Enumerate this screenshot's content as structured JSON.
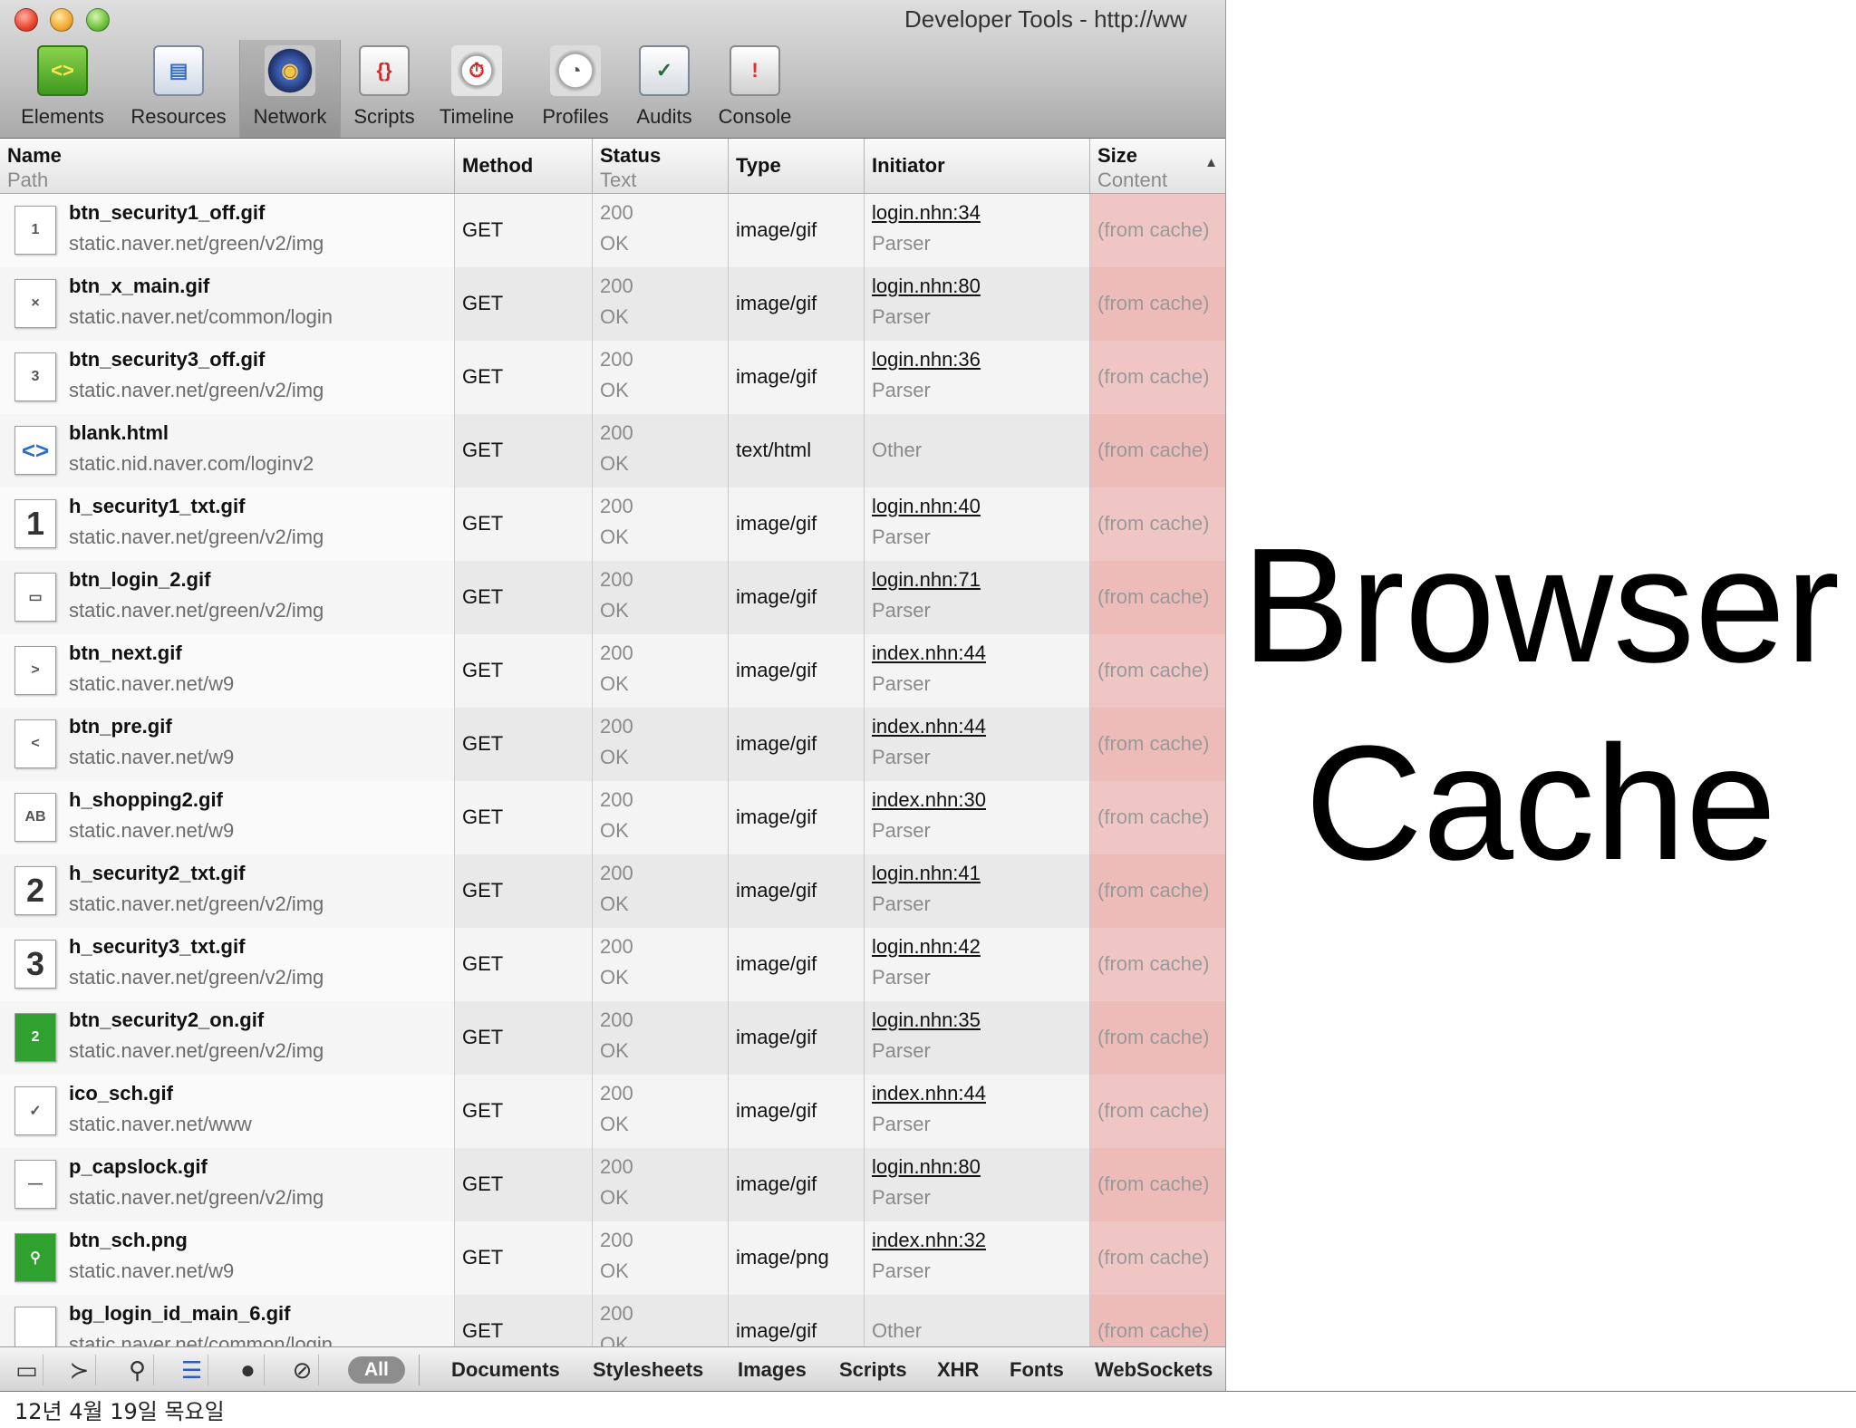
{
  "window": {
    "title": "Developer Tools - http://ww"
  },
  "toolbar": {
    "tabs": [
      {
        "label": "Elements",
        "icon": "elements-icon"
      },
      {
        "label": "Resources",
        "icon": "resources-icon"
      },
      {
        "label": "Network",
        "icon": "network-icon",
        "selected": true
      },
      {
        "label": "Scripts",
        "icon": "scripts-icon"
      },
      {
        "label": "Timeline",
        "icon": "timeline-icon"
      },
      {
        "label": "Profiles",
        "icon": "profiles-icon"
      },
      {
        "label": "Audits",
        "icon": "audits-icon"
      },
      {
        "label": "Console",
        "icon": "console-icon"
      }
    ]
  },
  "columns": {
    "name": "Name",
    "name_sub": "Path",
    "method": "Method",
    "status": "Status",
    "status_sub": "Text",
    "type": "Type",
    "initiator": "Initiator",
    "size": "Size",
    "size_sub": "Content",
    "sort_indicator": "▲"
  },
  "rows": [
    {
      "name": "btn_security1_off.gif",
      "path": "static.naver.net/green/v2/img",
      "method": "GET",
      "status": "200",
      "status_text": "OK",
      "type": "image/gif",
      "initiator": "login.nhn:34",
      "initiator_type": "Parser",
      "size": "(from cache)",
      "thumb": "1"
    },
    {
      "name": "btn_x_main.gif",
      "path": "static.naver.net/common/login",
      "method": "GET",
      "status": "200",
      "status_text": "OK",
      "type": "image/gif",
      "initiator": "login.nhn:80",
      "initiator_type": "Parser",
      "size": "(from cache)",
      "thumb": "×"
    },
    {
      "name": "btn_security3_off.gif",
      "path": "static.naver.net/green/v2/img",
      "method": "GET",
      "status": "200",
      "status_text": "OK",
      "type": "image/gif",
      "initiator": "login.nhn:36",
      "initiator_type": "Parser",
      "size": "(from cache)",
      "thumb": "3"
    },
    {
      "name": "blank.html",
      "path": "static.nid.naver.com/loginv2",
      "method": "GET",
      "status": "200",
      "status_text": "OK",
      "type": "text/html",
      "initiator": "Other",
      "initiator_type": "",
      "size": "(from cache)",
      "thumb": "<>"
    },
    {
      "name": "h_security1_txt.gif",
      "path": "static.naver.net/green/v2/img",
      "method": "GET",
      "status": "200",
      "status_text": "OK",
      "type": "image/gif",
      "initiator": "login.nhn:40",
      "initiator_type": "Parser",
      "size": "(from cache)",
      "thumb": "1"
    },
    {
      "name": "btn_login_2.gif",
      "path": "static.naver.net/green/v2/img",
      "method": "GET",
      "status": "200",
      "status_text": "OK",
      "type": "image/gif",
      "initiator": "login.nhn:71",
      "initiator_type": "Parser",
      "size": "(from cache)",
      "thumb": "▭"
    },
    {
      "name": "btn_next.gif",
      "path": "static.naver.net/w9",
      "method": "GET",
      "status": "200",
      "status_text": "OK",
      "type": "image/gif",
      "initiator": "index.nhn:44",
      "initiator_type": "Parser",
      "size": "(from cache)",
      "thumb": ">"
    },
    {
      "name": "btn_pre.gif",
      "path": "static.naver.net/w9",
      "method": "GET",
      "status": "200",
      "status_text": "OK",
      "type": "image/gif",
      "initiator": "index.nhn:44",
      "initiator_type": "Parser",
      "size": "(from cache)",
      "thumb": "<"
    },
    {
      "name": "h_shopping2.gif",
      "path": "static.naver.net/w9",
      "method": "GET",
      "status": "200",
      "status_text": "OK",
      "type": "image/gif",
      "initiator": "index.nhn:30",
      "initiator_type": "Parser",
      "size": "(from cache)",
      "thumb": "AB"
    },
    {
      "name": "h_security2_txt.gif",
      "path": "static.naver.net/green/v2/img",
      "method": "GET",
      "status": "200",
      "status_text": "OK",
      "type": "image/gif",
      "initiator": "login.nhn:41",
      "initiator_type": "Parser",
      "size": "(from cache)",
      "thumb": "2"
    },
    {
      "name": "h_security3_txt.gif",
      "path": "static.naver.net/green/v2/img",
      "method": "GET",
      "status": "200",
      "status_text": "OK",
      "type": "image/gif",
      "initiator": "login.nhn:42",
      "initiator_type": "Parser",
      "size": "(from cache)",
      "thumb": "3"
    },
    {
      "name": "btn_security2_on.gif",
      "path": "static.naver.net/green/v2/img",
      "method": "GET",
      "status": "200",
      "status_text": "OK",
      "type": "image/gif",
      "initiator": "login.nhn:35",
      "initiator_type": "Parser",
      "size": "(from cache)",
      "thumb": "2"
    },
    {
      "name": "ico_sch.gif",
      "path": "static.naver.net/www",
      "method": "GET",
      "status": "200",
      "status_text": "OK",
      "type": "image/gif",
      "initiator": "index.nhn:44",
      "initiator_type": "Parser",
      "size": "(from cache)",
      "thumb": "✓"
    },
    {
      "name": "p_capslock.gif",
      "path": "static.naver.net/green/v2/img",
      "method": "GET",
      "status": "200",
      "status_text": "OK",
      "type": "image/gif",
      "initiator": "login.nhn:80",
      "initiator_type": "Parser",
      "size": "(from cache)",
      "thumb": "—"
    },
    {
      "name": "btn_sch.png",
      "path": "static.naver.net/w9",
      "method": "GET",
      "status": "200",
      "status_text": "OK",
      "type": "image/png",
      "initiator": "index.nhn:32",
      "initiator_type": "Parser",
      "size": "(from cache)",
      "thumb": "⚲"
    },
    {
      "name": "bg_login_id_main_6.gif",
      "path": "static.naver.net/common/login",
      "method": "GET",
      "status": "200",
      "status_text": "OK",
      "type": "image/gif",
      "initiator": "Other",
      "initiator_type": "",
      "size": "(from cache)",
      "thumb": ""
    }
  ],
  "statusbar": {
    "buttons": [
      "dock-icon",
      "console-drawer-icon",
      "search-icon",
      "list-view-icon",
      "record-icon",
      "clear-icon"
    ],
    "all_label": "All",
    "filters": [
      "Documents",
      "Stylesheets",
      "Images",
      "Scripts",
      "XHR",
      "Fonts",
      "WebSockets"
    ]
  },
  "slide": {
    "title_line1": "Browser",
    "title_line2": "Cache",
    "date": "12년 4월 19일 목요일"
  },
  "colors": {
    "cache_column": "#f0c6c4",
    "selected_link": "#111111"
  }
}
